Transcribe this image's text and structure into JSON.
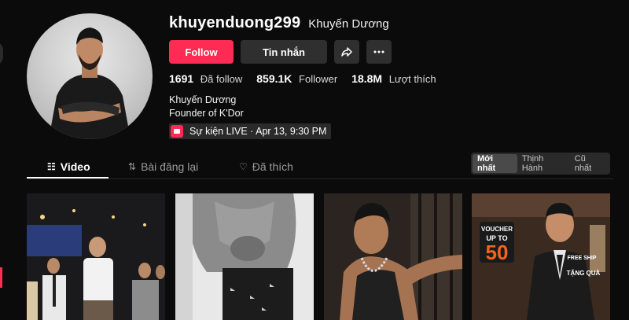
{
  "profile": {
    "username": "khuyenduong299",
    "nickname": "Khuyến Dương",
    "bio_name": "Khuyến Dương",
    "bio_title": "Founder of K'Dor"
  },
  "actions": {
    "follow_label": "Follow",
    "message_label": "Tin nhắn"
  },
  "stats": [
    {
      "value": "1691",
      "label": "Đã follow"
    },
    {
      "value": "859.1K",
      "label": "Follower"
    },
    {
      "value": "18.8M",
      "label": "Lượt thích"
    }
  ],
  "live_event": {
    "text": "Sự kiện LIVE · Apr 13, 9:30 PM"
  },
  "tabs": [
    {
      "label": "Video",
      "icon": "grid-icon"
    },
    {
      "label": "Bài đăng lại",
      "icon": "repost-icon"
    },
    {
      "label": "Đã thích",
      "icon": "heart-icon"
    }
  ],
  "sort": {
    "options": [
      "Mới nhất",
      "Thịnh Hành",
      "Cũ nhất"
    ],
    "selected": "Mới nhất"
  },
  "video_thumbnails": {
    "card4": {
      "voucher_title": "VOUCHER",
      "voucher_up": "UP TO",
      "voucher_value": "50",
      "free_ship": "FREE SHIP",
      "gift": "TẶNG QUÀ"
    }
  },
  "colors": {
    "accent": "#fe2c55",
    "background": "#0b0b0b",
    "button_secondary": "#2f2f2f"
  }
}
